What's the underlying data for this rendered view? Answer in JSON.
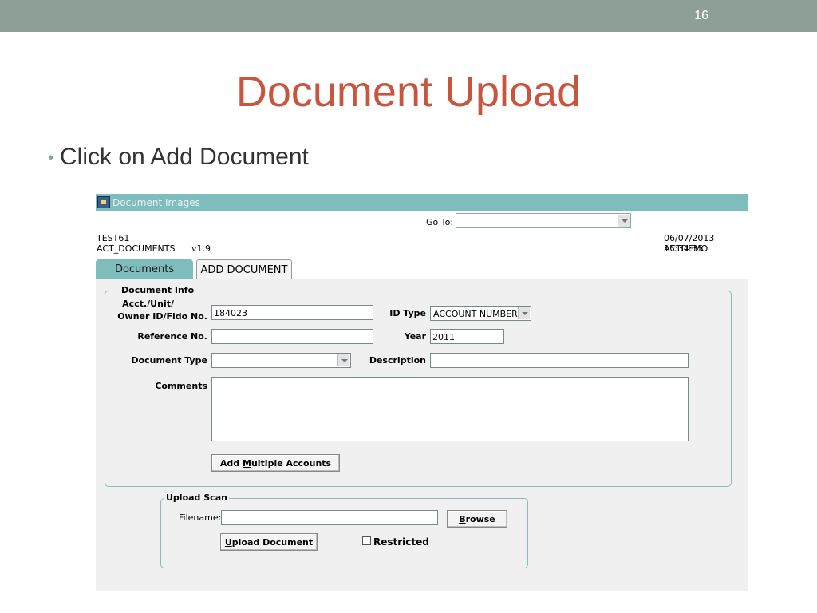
{
  "slide": {
    "number": "16",
    "title": "Document Upload",
    "bullet": "Click on Add Document"
  },
  "app": {
    "window_title": "Document Images",
    "goto": {
      "label": "Go To:",
      "value": ""
    },
    "info": {
      "line1": "TEST61",
      "module": "ACT_DOCUMENTS",
      "version": "v1.9",
      "datetime": "06/07/2013 15:34:35",
      "user": "ACTDEMO"
    },
    "tabs": [
      {
        "label": "Documents",
        "active": false
      },
      {
        "label": "ADD DOCUMENT",
        "active": true
      }
    ],
    "document_info": {
      "legend": "Document Info",
      "acct_label_1": "Acct./Unit/",
      "acct_label_2": "Owner ID/Fido No.",
      "acct_value": "184023",
      "id_type_label": "ID Type",
      "id_type_value": "ACCOUNT NUMBER",
      "reference_label": "Reference No.",
      "reference_value": "",
      "year_label": "Year",
      "year_value": "2011",
      "doc_type_label": "Document Type",
      "doc_type_value": "",
      "description_label": "Description",
      "description_value": "",
      "comments_label": "Comments",
      "comments_value": "",
      "add_multiple_pre": "Add ",
      "add_multiple_mnemonic": "M",
      "add_multiple_post": "ultiple Accounts"
    },
    "upload_scan": {
      "legend": "Upload Scan",
      "filename_label": "Filename:",
      "filename_value": "",
      "browse_mnemonic": "B",
      "browse_post": "rowse",
      "upload_mnemonic": "U",
      "upload_post": "pload Document",
      "restricted_label": "Restricted",
      "restricted_checked": false
    }
  }
}
